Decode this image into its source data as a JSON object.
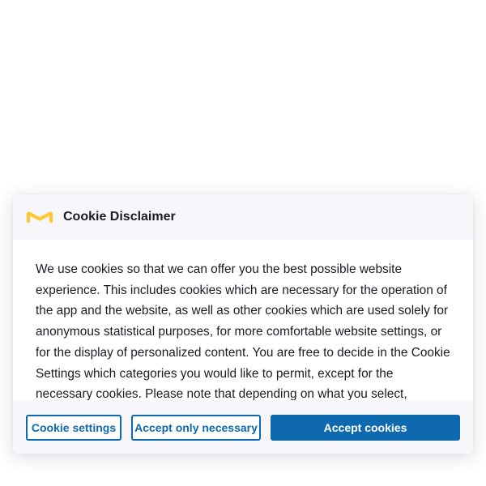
{
  "dialog": {
    "title": "Cookie Disclaimer",
    "logo_icon": "brand-m-logo-icon",
    "body": "We use cookies so that we can offer you the best possible website experience. This includes cookies which are necessary for the operation of the app and the website, as well as other cookies which are used solely for anonymous statistical purposes, for more comfortable website settings, or for the display of personalized content. You are free to decide in the Cookie Settings which categories you would like to permit, except for the necessary cookies. Please note that depending on what you select,"
  },
  "buttons": {
    "settings_label": "Cookie settings",
    "necessary_label": "Accept only necessary",
    "accept_label": "Accept cookies"
  },
  "colors": {
    "accent": "#0f69af",
    "logo": "#ffc832",
    "header_background": "#f7f7fb",
    "text": "#1b1b25"
  }
}
